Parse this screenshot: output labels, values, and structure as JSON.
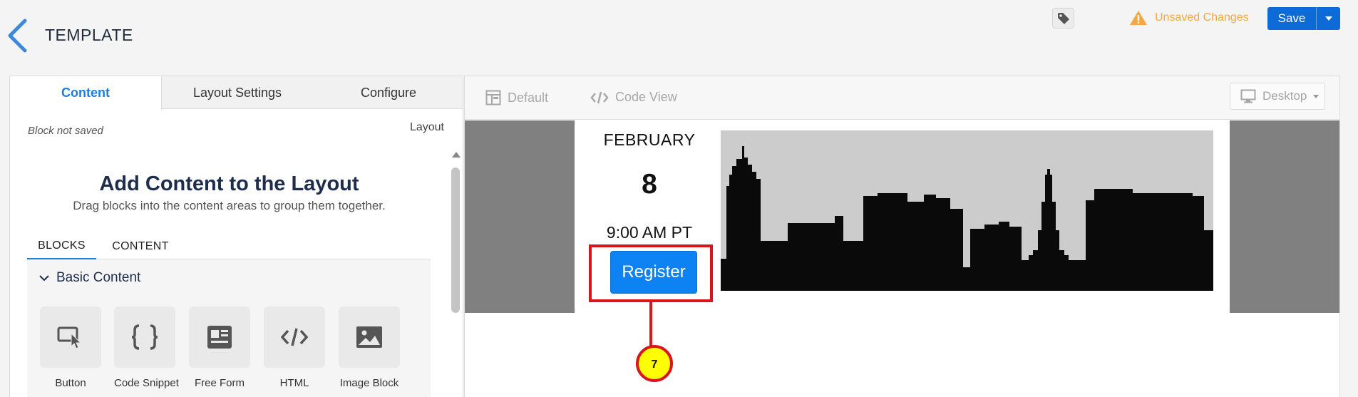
{
  "header": {
    "title": "TEMPLATE",
    "back_icon": "chevron-left-icon",
    "tag_icon": "tag-icon",
    "unsaved_text": "Unsaved Changes",
    "warning_icon": "warning-icon",
    "save_label": "Save",
    "save_menu_icon": "caret-down-icon"
  },
  "left_panel": {
    "tabs": [
      {
        "label": "Content",
        "active": true
      },
      {
        "label": "Layout Settings",
        "active": false
      },
      {
        "label": "Configure",
        "active": false
      }
    ],
    "block_status": "Block not saved",
    "layout_link": "Layout",
    "heading": "Add Content to the Layout",
    "subheading": "Drag blocks into the content areas to group them together.",
    "sub_tabs": [
      {
        "label": "BLOCKS",
        "active": true
      },
      {
        "label": "CONTENT",
        "active": false
      }
    ],
    "section": {
      "title": "Basic Content",
      "expanded": true,
      "blocks": [
        {
          "label": "Button",
          "icon": "button-cursor-icon"
        },
        {
          "label": "Code Snippet",
          "icon": "curly-braces-icon"
        },
        {
          "label": "Free Form",
          "icon": "free-form-icon"
        },
        {
          "label": "HTML",
          "icon": "code-icon"
        },
        {
          "label": "Image Block",
          "icon": "image-icon"
        }
      ]
    }
  },
  "right_panel": {
    "toolbar": {
      "default_label": "Default",
      "code_view_label": "Code View",
      "device_label": "Desktop"
    },
    "preview": {
      "month": "FEBRUARY",
      "day": "8",
      "time": "9:00 AM PT",
      "register_label": "Register"
    }
  },
  "annotation": {
    "step_number": "7",
    "highlight_color": "#d9161c",
    "badge_color": "#ffff00"
  },
  "colors": {
    "accent": "#1c7fe0",
    "primary_button": "#0d6ad6",
    "warning": "#f4a742",
    "canvas_gray": "#808080"
  }
}
